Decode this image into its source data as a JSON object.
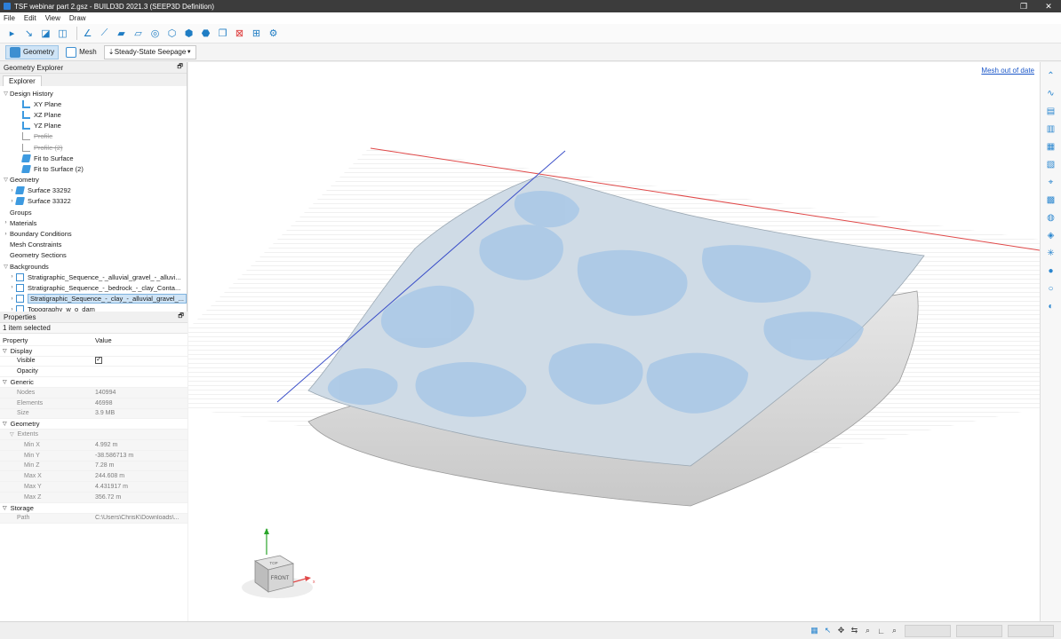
{
  "window": {
    "title": "TSF webinar part 2.gsz - BUILD3D 2021.3 (SEEP3D Definition)",
    "controls": {
      "restore": "❐",
      "close": "✕"
    }
  },
  "menu": [
    "File",
    "Edit",
    "View",
    "Draw"
  ],
  "modes": {
    "geometry": "Geometry",
    "mesh": "Mesh",
    "analysis": "Steady-State Seepage"
  },
  "explorer": {
    "title": "Geometry Explorer",
    "tab": "Explorer",
    "tree": [
      {
        "label": "Design History",
        "level": 0,
        "toggle": "▽"
      },
      {
        "label": "XY Plane",
        "level": 2,
        "icon": "plane"
      },
      {
        "label": "XZ Plane",
        "level": 2,
        "icon": "plane"
      },
      {
        "label": "YZ Plane",
        "level": 2,
        "icon": "plane"
      },
      {
        "label": "Profile",
        "level": 2,
        "icon": "prof",
        "disabled": true
      },
      {
        "label": "Profile (2)",
        "level": 2,
        "icon": "prof",
        "disabled": true
      },
      {
        "label": "Fit to Surface",
        "level": 2,
        "icon": "blue"
      },
      {
        "label": "Fit to Surface (2)",
        "level": 2,
        "icon": "blue"
      },
      {
        "label": "Geometry",
        "level": 0,
        "toggle": "▽"
      },
      {
        "label": "Surface 33292",
        "level": 1,
        "icon": "blue",
        "toggle": "›"
      },
      {
        "label": "Surface 33322",
        "level": 1,
        "icon": "blue",
        "toggle": "›"
      },
      {
        "label": "Groups",
        "level": 0
      },
      {
        "label": "Materials",
        "level": 0,
        "toggle": "›"
      },
      {
        "label": "Boundary Conditions",
        "level": 0,
        "toggle": "›"
      },
      {
        "label": "Mesh Constraints",
        "level": 0
      },
      {
        "label": "Geometry Sections",
        "level": 0
      },
      {
        "label": "Backgrounds",
        "level": 0,
        "toggle": "▽"
      },
      {
        "label": "Stratigraphic_Sequence_-_alluvial_gravel_-_alluvi...",
        "level": 1,
        "icon": "bg",
        "toggle": "›"
      },
      {
        "label": "Stratigraphic_Sequence_-_bedrock_-_clay_Conta...",
        "level": 1,
        "icon": "bg",
        "toggle": "›"
      },
      {
        "label": "Stratigraphic_Sequence_-_clay_-_alluvial_gravel_...",
        "level": 1,
        "icon": "bg",
        "toggle": "›",
        "selected": true
      },
      {
        "label": "Topography_w_o_dam",
        "level": 1,
        "icon": "bg",
        "toggle": "›"
      }
    ]
  },
  "properties": {
    "title": "Properties",
    "selection": "1 item selected",
    "header": {
      "property": "Property",
      "value": "Value"
    },
    "rows": [
      {
        "type": "cat",
        "key": "Display",
        "toggle": "▽"
      },
      {
        "type": "row",
        "key": "Visible",
        "value": "",
        "checkbox": true,
        "indent": 2
      },
      {
        "type": "row",
        "key": "Opacity",
        "value": "",
        "indent": 2
      },
      {
        "type": "cat",
        "key": "Generic",
        "toggle": "▽"
      },
      {
        "type": "sub",
        "key": "Nodes",
        "value": "140994",
        "indent": 2
      },
      {
        "type": "sub",
        "key": "Elements",
        "value": "46998",
        "indent": 2
      },
      {
        "type": "sub",
        "key": "Size",
        "value": "3.9 MB",
        "indent": 2
      },
      {
        "type": "cat",
        "key": "Geometry",
        "toggle": "▽"
      },
      {
        "type": "sub",
        "key": "Extents",
        "value": "",
        "indent": 1,
        "toggle": "▽"
      },
      {
        "type": "sub",
        "key": "Min X",
        "value": "4.992 m",
        "indent": 3
      },
      {
        "type": "sub",
        "key": "Min Y",
        "value": "-38.586713 m",
        "indent": 3
      },
      {
        "type": "sub",
        "key": "Min Z",
        "value": "7.28 m",
        "indent": 3
      },
      {
        "type": "sub",
        "key": "Max X",
        "value": "244.608 m",
        "indent": 3
      },
      {
        "type": "sub",
        "key": "Max Y",
        "value": "4.431917 m",
        "indent": 3
      },
      {
        "type": "sub",
        "key": "Max Z",
        "value": "356.72 m",
        "indent": 3
      },
      {
        "type": "cat",
        "key": "Storage",
        "toggle": "▽"
      },
      {
        "type": "sub",
        "key": "Path",
        "value": "C:\\Users\\ChrisK\\Downloads\\...",
        "indent": 2
      }
    ]
  },
  "viewport": {
    "mesh_status": "Mesh out of date",
    "view_cube": {
      "front": "FRONT",
      "top": "TOP",
      "axis_x": "x",
      "axis_y": "y"
    }
  },
  "toolbar_icons": [
    "select-arrow-icon",
    "draw-line-icon",
    "draw-point-icon",
    "split-icon",
    "sketch-icon",
    "fit-surface-icon",
    "surface-icon",
    "shape-icon",
    "target-icon",
    "cube-icon",
    "solid-cube-icon",
    "half-cube-icon",
    "stack-cube-icon",
    "delete-shape-icon",
    "settings-view-icon",
    "gear-icon"
  ],
  "rightbar_icons": [
    "up-arrow-icon",
    "wave-icon",
    "layer-icon",
    "layer-2-icon",
    "layer-3-icon",
    "layer-4-icon",
    "probe-icon",
    "grid-icon",
    "bucket-icon",
    "cube-icon",
    "sun-icon",
    "sphere-icon",
    "search-icon",
    "drop-icon"
  ],
  "statusbar_icons": [
    "grid-icon",
    "cursor-icon",
    "move-icon",
    "orbit-icon",
    "zoom-icon",
    "axis-icon",
    "magnify-icon"
  ]
}
